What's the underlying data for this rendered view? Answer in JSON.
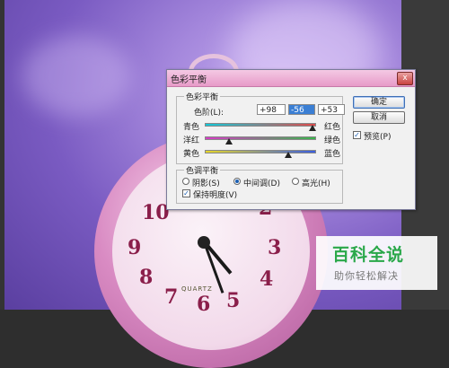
{
  "dialog": {
    "title": "色彩平衡",
    "close_glyph": "x",
    "color_balance_group": "色彩平衡",
    "levels_label": "色阶(L):",
    "levels": [
      "+98",
      "-56",
      "+53"
    ],
    "sliders": [
      {
        "left": "青色",
        "right": "红色",
        "value": 98
      },
      {
        "left": "洋红",
        "right": "绿色",
        "value": -56
      },
      {
        "left": "黄色",
        "right": "蓝色",
        "value": 53
      }
    ],
    "tone_group": "色调平衡",
    "tones": [
      {
        "label": "阴影(S)",
        "selected": false
      },
      {
        "label": "中间调(D)",
        "selected": true
      },
      {
        "label": "高光(H)",
        "selected": false
      }
    ],
    "preserve_luminosity": {
      "label": "保持明度(V)",
      "checked": true
    },
    "buttons": {
      "ok": "确定",
      "cancel": "取消"
    },
    "preview": {
      "label": "预览(P)",
      "checked": true
    }
  },
  "clock": {
    "numbers": [
      "10",
      "2",
      "9",
      "3",
      "8",
      "4",
      "7",
      "6",
      "5"
    ],
    "brand": "QUARTZ"
  },
  "watermark": {
    "title": "百科全说",
    "subtitle": "助你轻松解决"
  },
  "colors": {
    "accent": "#1b5fb3",
    "titlebar": "#e79ac8",
    "watermark_green": "#2aa84a"
  }
}
